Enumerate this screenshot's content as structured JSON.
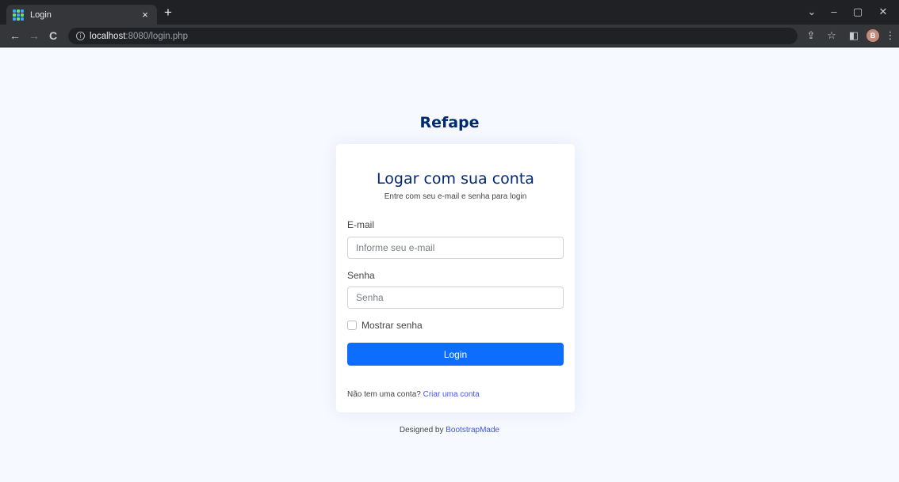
{
  "browser": {
    "tab_title": "Login",
    "tab_close": "×",
    "new_tab": "+",
    "url_host": "localhost",
    "url_rest": ":8080/login.php",
    "profile_initial": "B",
    "window_controls": {
      "tabsearch": "⌄",
      "minimize": "–",
      "maximize": "▢",
      "close": "✕"
    },
    "nav": {
      "back": "←",
      "forward": "→",
      "reload": "C"
    },
    "toolbar_icons": {
      "share": "⇪",
      "bookmark": "☆",
      "sidepanel": "◧",
      "menu": "⋮"
    }
  },
  "page": {
    "brand": "Refape",
    "card": {
      "title": "Logar com sua conta",
      "subtitle": "Entre com seu e-mail e senha para login",
      "email_label": "E-mail",
      "email_placeholder": "Informe seu e-mail",
      "password_label": "Senha",
      "password_placeholder": "Senha",
      "show_password_label": "Mostrar senha",
      "login_button": "Login",
      "signup_prompt": "Não tem uma conta?",
      "signup_link": "Criar uma conta"
    },
    "credits_prefix": "Designed by",
    "credits_link": "BootstrapMade"
  },
  "colors": {
    "brand": "#012970",
    "accent": "#0d6efd",
    "link": "#4154f1",
    "background": "#f6f9ff"
  }
}
